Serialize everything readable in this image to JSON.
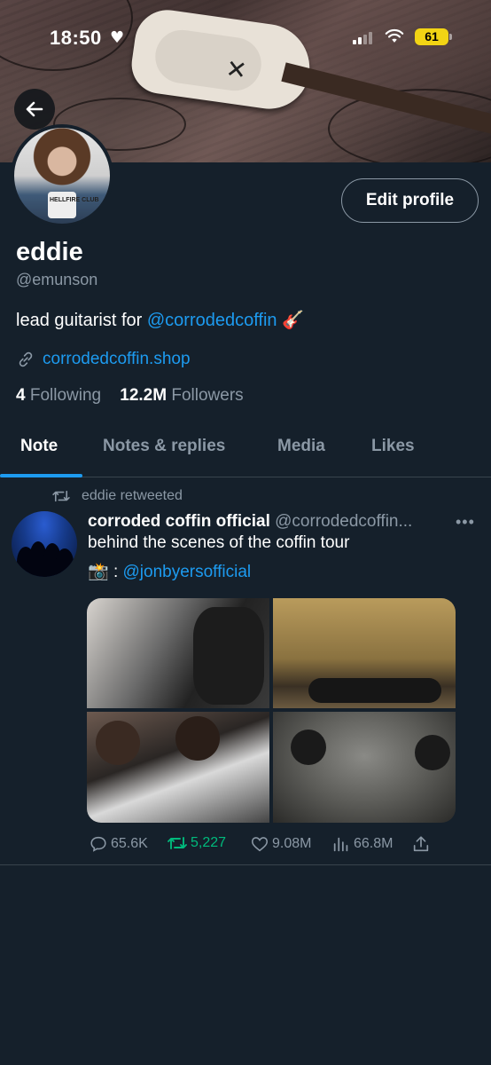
{
  "status_bar": {
    "time": "18:50",
    "battery": "61"
  },
  "profile": {
    "name": "eddie",
    "handle": "@emunson",
    "bio_text": "lead guitarist for ",
    "bio_mention": "@corrodedcoffin",
    "bio_emoji": "🎸",
    "link": "corrodedcoffin.shop",
    "following_count": "4",
    "following_label": "Following",
    "followers_count": "12.2M",
    "followers_label": "Followers",
    "edit_button": "Edit profile",
    "avatar_shirt_text": "HELLFIRE CLUB"
  },
  "tabs": [
    {
      "label": "Note"
    },
    {
      "label": "Notes & replies"
    },
    {
      "label": "Media"
    },
    {
      "label": "Likes"
    }
  ],
  "tweet": {
    "retweeted_by": "eddie retweeted",
    "display_name": "corroded coffin official",
    "handle": "@corrodedcoffin...",
    "more": "•••",
    "text": "behind the scenes of the coffin tour",
    "credit_emoji": "📸",
    "credit_sep": " : ",
    "credit_mention": "@jonbyersofficial",
    "replies": "65.6K",
    "retweets": "5,227",
    "likes": "9.08M",
    "views": "66.8M"
  },
  "colors": {
    "background": "#15202b",
    "accent": "#1d9bf0",
    "muted": "#8b98a5",
    "retweet": "#00ba7c",
    "battery": "#f2d414"
  },
  "icons": [
    "back-arrow-icon",
    "link-icon",
    "retweet-icon",
    "reply-icon",
    "like-icon",
    "views-icon",
    "share-icon",
    "heart-icon",
    "wifi-icon",
    "signal-icon"
  ]
}
